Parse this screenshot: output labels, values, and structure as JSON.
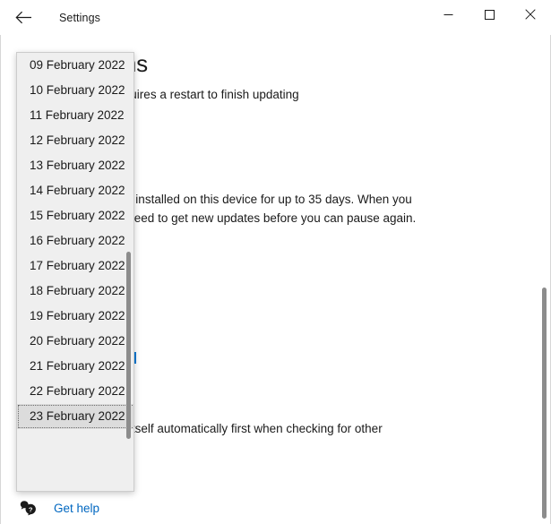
{
  "window": {
    "title": "Settings",
    "back_icon": "back-arrow-icon",
    "minimize_label": "—",
    "maximize_label": "□",
    "close_label": "✕"
  },
  "page": {
    "title": "ed options",
    "restart_text": "hen your PC requires a restart to finish updating",
    "pause_paragraph": "dates from being installed on this device for up to 35 days. When you your device will need to get new updates before you can pause again.",
    "pause_paragraph_line1": "dates from being installed on this device for up to 35 days. When you",
    "pause_paragraph_line2": "your device will need to get new updates before you can pause again.",
    "other_products_text": "te might update itself automatically first when checking for other"
  },
  "footer": {
    "get_help_label": "Get help",
    "get_help_icon": "help-bubble-icon"
  },
  "dropdown": {
    "selected_value": "23 February 2022",
    "items": [
      {
        "label": "09 February 2022",
        "selected": false
      },
      {
        "label": "10 February 2022",
        "selected": false
      },
      {
        "label": "11 February 2022",
        "selected": false
      },
      {
        "label": "12 February 2022",
        "selected": false
      },
      {
        "label": "13 February 2022",
        "selected": false
      },
      {
        "label": "14 February 2022",
        "selected": false
      },
      {
        "label": "15 February 2022",
        "selected": false
      },
      {
        "label": "16 February 2022",
        "selected": false
      },
      {
        "label": "17 February 2022",
        "selected": false
      },
      {
        "label": "18 February 2022",
        "selected": false
      },
      {
        "label": "19 February 2022",
        "selected": false
      },
      {
        "label": "20 February 2022",
        "selected": false
      },
      {
        "label": "21 February 2022",
        "selected": false
      },
      {
        "label": "22 February 2022",
        "selected": false
      },
      {
        "label": "23 February 2022",
        "selected": true
      }
    ]
  },
  "colors": {
    "link": "#0067c0",
    "accent": "#0078d4",
    "dropdown_bg": "#efefef",
    "dropdown_selected_bg": "#dcdcdc",
    "scrollbar_thumb": "#8c8c8c"
  }
}
